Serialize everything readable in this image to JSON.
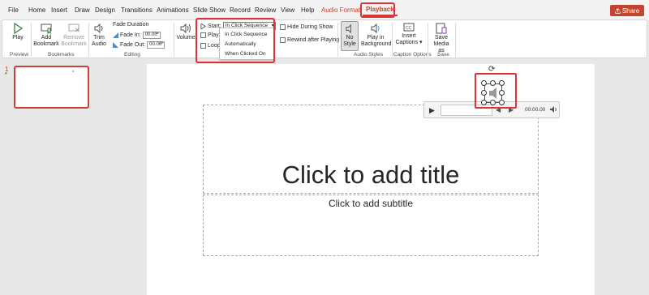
{
  "menubar": {
    "items": [
      "File",
      "Home",
      "Insert",
      "Draw",
      "Design",
      "Transitions",
      "Animations",
      "Slide Show",
      "Record",
      "Review",
      "View",
      "Help",
      "Audio Format",
      "Playback"
    ],
    "share": "Share",
    "accent": "#c4452f",
    "highlight": "#e0303a"
  },
  "ribbon": {
    "play": "Play",
    "add_bookmark": [
      "Add",
      "Bookmark"
    ],
    "remove_bookmark": [
      "Remove",
      "Bookmark"
    ],
    "trim_audio": [
      "Trim",
      "Audio"
    ],
    "fade_duration": "Fade Duration",
    "fade_in_label": "Fade In:",
    "fade_in_value": "00.00",
    "fade_out_label": "Fade Out:",
    "fade_out_value": "00.00",
    "volume": "Volume",
    "start_label": "Start:",
    "start_value": "In Click Sequence",
    "play_across": "Play A",
    "loop": "Loop u",
    "hide_during_show": "Hide During Show",
    "rewind_after_playing": "Rewind after Playing",
    "no_style": [
      "No",
      "Style"
    ],
    "play_in_background": [
      "Play in",
      "Background"
    ],
    "insert_captions": [
      "Insert",
      "Captions"
    ],
    "save_media_as": [
      "Save",
      "Media as"
    ],
    "groups": {
      "preview": "Preview",
      "bookmarks": "Bookmarks",
      "editing": "Editing",
      "audio_styles": "Audio Styles",
      "caption_options": "Caption Options",
      "save": "Save"
    },
    "start_options": [
      "In Click Sequence",
      "Automatically",
      "When Clicked On"
    ]
  },
  "thumbnails": {
    "slide_number": "1",
    "star": "*"
  },
  "slide": {
    "title_placeholder": "Click to add title",
    "subtitle_placeholder": "Click to add subtitle"
  },
  "player": {
    "time": "00:00.00"
  }
}
